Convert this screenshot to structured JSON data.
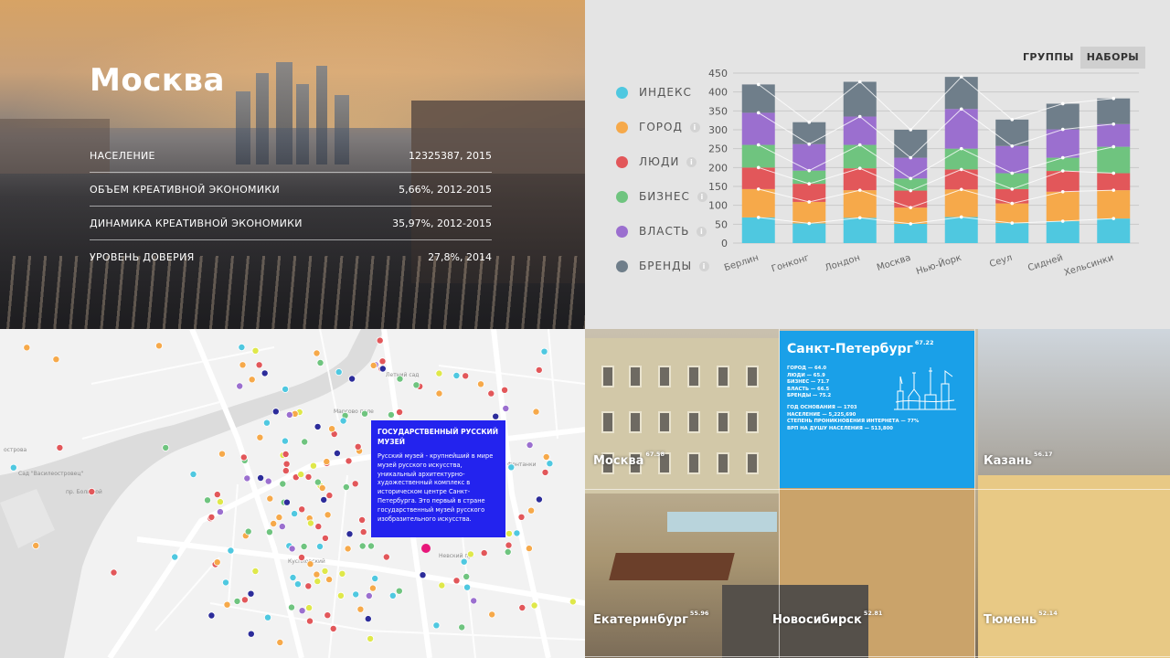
{
  "moscow": {
    "title": "Москва",
    "stats": [
      {
        "label": "Население",
        "value": "12325387, 2015"
      },
      {
        "label": "Объем креативной экономики",
        "value": "5,66%, 2012-2015"
      },
      {
        "label": "Динамика креативной экономики",
        "value": "35,97%, 2012-2015"
      },
      {
        "label": "Уровень доверия",
        "value": "27,8%, 2014"
      }
    ]
  },
  "chart_panel": {
    "toggle": {
      "groups": "ГРУППЫ",
      "sets": "НАБОРЫ",
      "active": "sets"
    },
    "legend": [
      {
        "label": "ИНДЕКС",
        "color": "#4fc8e0",
        "info": false
      },
      {
        "label": "ГОРОД",
        "color": "#f6a94a",
        "info": true
      },
      {
        "label": "ЛЮДИ",
        "color": "#e2575a",
        "info": true
      },
      {
        "label": "БИЗНЕС",
        "color": "#6fc47f",
        "info": true
      },
      {
        "label": "ВЛАСТЬ",
        "color": "#9b6fcf",
        "info": true
      },
      {
        "label": "БРЕНДЫ",
        "color": "#6f7e8a",
        "info": true
      }
    ],
    "info_icon": "i"
  },
  "chart_data": {
    "type": "bar",
    "stacked": true,
    "categories": [
      "Берлин",
      "Гонконг",
      "Лондон",
      "Москва",
      "Нью-Йорк",
      "Сеул",
      "Сидней",
      "Хельсинки"
    ],
    "ylim": [
      0,
      450
    ],
    "yticks": [
      0,
      50,
      100,
      150,
      200,
      250,
      300,
      350,
      400,
      450
    ],
    "grid": true,
    "series": [
      {
        "name": "ИНДЕКС",
        "color": "#4fc8e0",
        "values": [
          68,
          52,
          67,
          51,
          69,
          53,
          58,
          65
        ]
      },
      {
        "name": "ГОРОД",
        "color": "#f6a94a",
        "values": [
          75,
          57,
          73,
          43,
          73,
          52,
          78,
          75
        ]
      },
      {
        "name": "ЛЮДИ",
        "color": "#e2575a",
        "values": [
          57,
          48,
          58,
          45,
          53,
          38,
          55,
          45
        ]
      },
      {
        "name": "БИЗНЕС",
        "color": "#6fc47f",
        "values": [
          60,
          35,
          62,
          32,
          55,
          42,
          35,
          70
        ]
      },
      {
        "name": "ВЛАСТЬ",
        "color": "#9b6fcf",
        "values": [
          85,
          70,
          75,
          55,
          105,
          72,
          75,
          60
        ]
      },
      {
        "name": "БРЕНДЫ",
        "color": "#6f7e8a",
        "values": [
          75,
          58,
          92,
          74,
          85,
          70,
          68,
          68
        ]
      }
    ]
  },
  "map": {
    "popup": {
      "title": "Государственный Русский музей",
      "text": "Русский музей - крупнейший в мире музей русского искусства, уникальный архитектурно-художественный комплекс в историческом центре Санкт-Петербурга. Это первый в стране государственный музей русского изобразительного искусства."
    },
    "labels": {
      "garden": "Сад \"Василеостровец\"",
      "summer": "Летний сад",
      "marsovo": "Марсово поле",
      "kusp": "Куспловский",
      "nevsky": "Невский пр.",
      "bolshoy": "пр. Большой",
      "fontanka": "наб. Фонтанки",
      "ostrov": "острова"
    }
  },
  "cities": {
    "spb": {
      "name": "Санкт-Петербург",
      "score": "67.22",
      "facts": [
        "Город — 64.0",
        "Люди — 65.9",
        "Бизнес — 71.7",
        "Власть — 66.5",
        "Бренды — 75.2"
      ],
      "facts2": [
        "Год основания — 1703",
        "Население — 5,225,690",
        "Степень проникновения интернета — 77%",
        "ВРП на душу населения — 513,800"
      ]
    },
    "moscow": {
      "name": "Москва",
      "score": "67.58"
    },
    "kazan": {
      "name": "Казань",
      "score": "56.17"
    },
    "ekb": {
      "name": "Екатеринбург",
      "score": "55.96"
    },
    "nsk": {
      "name": "Новосибирск",
      "score": "52.81"
    },
    "tyumen": {
      "name": "Тюмень",
      "score": "52.14"
    }
  }
}
